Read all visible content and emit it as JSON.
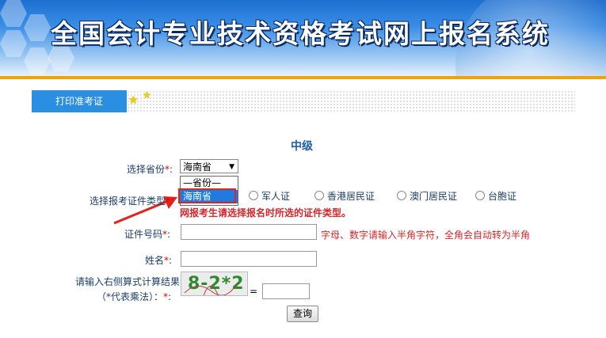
{
  "banner": {
    "title": "全国会计专业技术资格考试网上报名系统"
  },
  "tab": {
    "label": "打印准考证"
  },
  "level": "中级",
  "form": {
    "province_label": "选择省份",
    "province_value": "海南省",
    "province_options": [
      "—省份—",
      "海南省"
    ],
    "cert_type_label": "选择报考证件类型",
    "cert_types": [
      "军人证",
      "香港居民证",
      "澳门居民证",
      "台胞证"
    ],
    "warning": "网报考生请选择报名时所选的证件类型。",
    "id_number_label": "证件号码",
    "id_number_value": "",
    "id_hint": "字母、数字请输入半角字符，全角会自动转为半角",
    "name_label": "姓名",
    "name_value": "",
    "captcha_label_line1": "请输入右侧算式计算结果",
    "captcha_label_line2": "（*代表乘法）：",
    "captcha_text": "8-2*2",
    "equals": "=",
    "captcha_answer": "",
    "required_mark": "*",
    "colon": ":",
    "submit_label": "查询"
  },
  "colors": {
    "accent": "#2a8ee2",
    "warning": "#d8262a",
    "highlight": "#e8201a",
    "banner_bar": "#f1a10c"
  }
}
